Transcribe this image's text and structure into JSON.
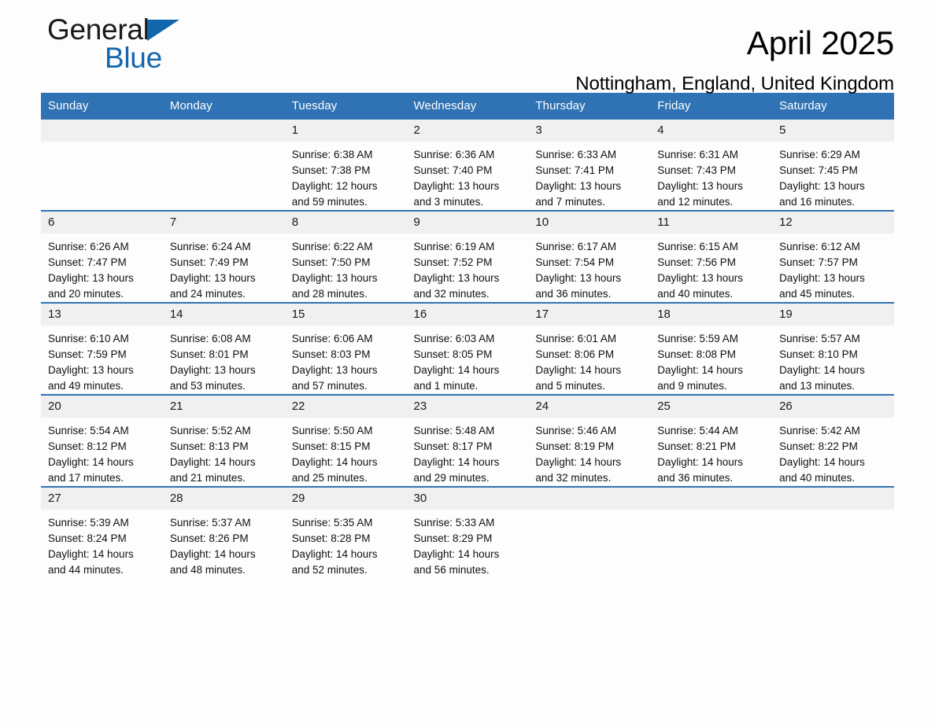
{
  "brand": {
    "name_part1": "General",
    "name_part2": "Blue",
    "accent_color": "#1267ac"
  },
  "header": {
    "title": "April 2025",
    "subtitle": "Nottingham, England, United Kingdom",
    "header_bg_color": "#3073b4",
    "daynum_bg_color": "#f0f0f0"
  },
  "weekdays": [
    "Sunday",
    "Monday",
    "Tuesday",
    "Wednesday",
    "Thursday",
    "Friday",
    "Saturday"
  ],
  "labels": {
    "sunrise_prefix": "Sunrise:",
    "sunset_prefix": "Sunset:",
    "daylight_prefix": "Daylight:"
  },
  "weeks": [
    [
      {
        "day": "",
        "lines": []
      },
      {
        "day": "",
        "lines": []
      },
      {
        "day": "1",
        "lines": [
          "Sunrise: 6:38 AM",
          "Sunset: 7:38 PM",
          "Daylight: 12 hours",
          "and 59 minutes."
        ]
      },
      {
        "day": "2",
        "lines": [
          "Sunrise: 6:36 AM",
          "Sunset: 7:40 PM",
          "Daylight: 13 hours",
          "and 3 minutes."
        ]
      },
      {
        "day": "3",
        "lines": [
          "Sunrise: 6:33 AM",
          "Sunset: 7:41 PM",
          "Daylight: 13 hours",
          "and 7 minutes."
        ]
      },
      {
        "day": "4",
        "lines": [
          "Sunrise: 6:31 AM",
          "Sunset: 7:43 PM",
          "Daylight: 13 hours",
          "and 12 minutes."
        ]
      },
      {
        "day": "5",
        "lines": [
          "Sunrise: 6:29 AM",
          "Sunset: 7:45 PM",
          "Daylight: 13 hours",
          "and 16 minutes."
        ]
      }
    ],
    [
      {
        "day": "6",
        "lines": [
          "Sunrise: 6:26 AM",
          "Sunset: 7:47 PM",
          "Daylight: 13 hours",
          "and 20 minutes."
        ]
      },
      {
        "day": "7",
        "lines": [
          "Sunrise: 6:24 AM",
          "Sunset: 7:49 PM",
          "Daylight: 13 hours",
          "and 24 minutes."
        ]
      },
      {
        "day": "8",
        "lines": [
          "Sunrise: 6:22 AM",
          "Sunset: 7:50 PM",
          "Daylight: 13 hours",
          "and 28 minutes."
        ]
      },
      {
        "day": "9",
        "lines": [
          "Sunrise: 6:19 AM",
          "Sunset: 7:52 PM",
          "Daylight: 13 hours",
          "and 32 minutes."
        ]
      },
      {
        "day": "10",
        "lines": [
          "Sunrise: 6:17 AM",
          "Sunset: 7:54 PM",
          "Daylight: 13 hours",
          "and 36 minutes."
        ]
      },
      {
        "day": "11",
        "lines": [
          "Sunrise: 6:15 AM",
          "Sunset: 7:56 PM",
          "Daylight: 13 hours",
          "and 40 minutes."
        ]
      },
      {
        "day": "12",
        "lines": [
          "Sunrise: 6:12 AM",
          "Sunset: 7:57 PM",
          "Daylight: 13 hours",
          "and 45 minutes."
        ]
      }
    ],
    [
      {
        "day": "13",
        "lines": [
          "Sunrise: 6:10 AM",
          "Sunset: 7:59 PM",
          "Daylight: 13 hours",
          "and 49 minutes."
        ]
      },
      {
        "day": "14",
        "lines": [
          "Sunrise: 6:08 AM",
          "Sunset: 8:01 PM",
          "Daylight: 13 hours",
          "and 53 minutes."
        ]
      },
      {
        "day": "15",
        "lines": [
          "Sunrise: 6:06 AM",
          "Sunset: 8:03 PM",
          "Daylight: 13 hours",
          "and 57 minutes."
        ]
      },
      {
        "day": "16",
        "lines": [
          "Sunrise: 6:03 AM",
          "Sunset: 8:05 PM",
          "Daylight: 14 hours",
          "and 1 minute."
        ]
      },
      {
        "day": "17",
        "lines": [
          "Sunrise: 6:01 AM",
          "Sunset: 8:06 PM",
          "Daylight: 14 hours",
          "and 5 minutes."
        ]
      },
      {
        "day": "18",
        "lines": [
          "Sunrise: 5:59 AM",
          "Sunset: 8:08 PM",
          "Daylight: 14 hours",
          "and 9 minutes."
        ]
      },
      {
        "day": "19",
        "lines": [
          "Sunrise: 5:57 AM",
          "Sunset: 8:10 PM",
          "Daylight: 14 hours",
          "and 13 minutes."
        ]
      }
    ],
    [
      {
        "day": "20",
        "lines": [
          "Sunrise: 5:54 AM",
          "Sunset: 8:12 PM",
          "Daylight: 14 hours",
          "and 17 minutes."
        ]
      },
      {
        "day": "21",
        "lines": [
          "Sunrise: 5:52 AM",
          "Sunset: 8:13 PM",
          "Daylight: 14 hours",
          "and 21 minutes."
        ]
      },
      {
        "day": "22",
        "lines": [
          "Sunrise: 5:50 AM",
          "Sunset: 8:15 PM",
          "Daylight: 14 hours",
          "and 25 minutes."
        ]
      },
      {
        "day": "23",
        "lines": [
          "Sunrise: 5:48 AM",
          "Sunset: 8:17 PM",
          "Daylight: 14 hours",
          "and 29 minutes."
        ]
      },
      {
        "day": "24",
        "lines": [
          "Sunrise: 5:46 AM",
          "Sunset: 8:19 PM",
          "Daylight: 14 hours",
          "and 32 minutes."
        ]
      },
      {
        "day": "25",
        "lines": [
          "Sunrise: 5:44 AM",
          "Sunset: 8:21 PM",
          "Daylight: 14 hours",
          "and 36 minutes."
        ]
      },
      {
        "day": "26",
        "lines": [
          "Sunrise: 5:42 AM",
          "Sunset: 8:22 PM",
          "Daylight: 14 hours",
          "and 40 minutes."
        ]
      }
    ],
    [
      {
        "day": "27",
        "lines": [
          "Sunrise: 5:39 AM",
          "Sunset: 8:24 PM",
          "Daylight: 14 hours",
          "and 44 minutes."
        ]
      },
      {
        "day": "28",
        "lines": [
          "Sunrise: 5:37 AM",
          "Sunset: 8:26 PM",
          "Daylight: 14 hours",
          "and 48 minutes."
        ]
      },
      {
        "day": "29",
        "lines": [
          "Sunrise: 5:35 AM",
          "Sunset: 8:28 PM",
          "Daylight: 14 hours",
          "and 52 minutes."
        ]
      },
      {
        "day": "30",
        "lines": [
          "Sunrise: 5:33 AM",
          "Sunset: 8:29 PM",
          "Daylight: 14 hours",
          "and 56 minutes."
        ]
      },
      {
        "day": "",
        "lines": []
      },
      {
        "day": "",
        "lines": []
      },
      {
        "day": "",
        "lines": []
      }
    ]
  ]
}
